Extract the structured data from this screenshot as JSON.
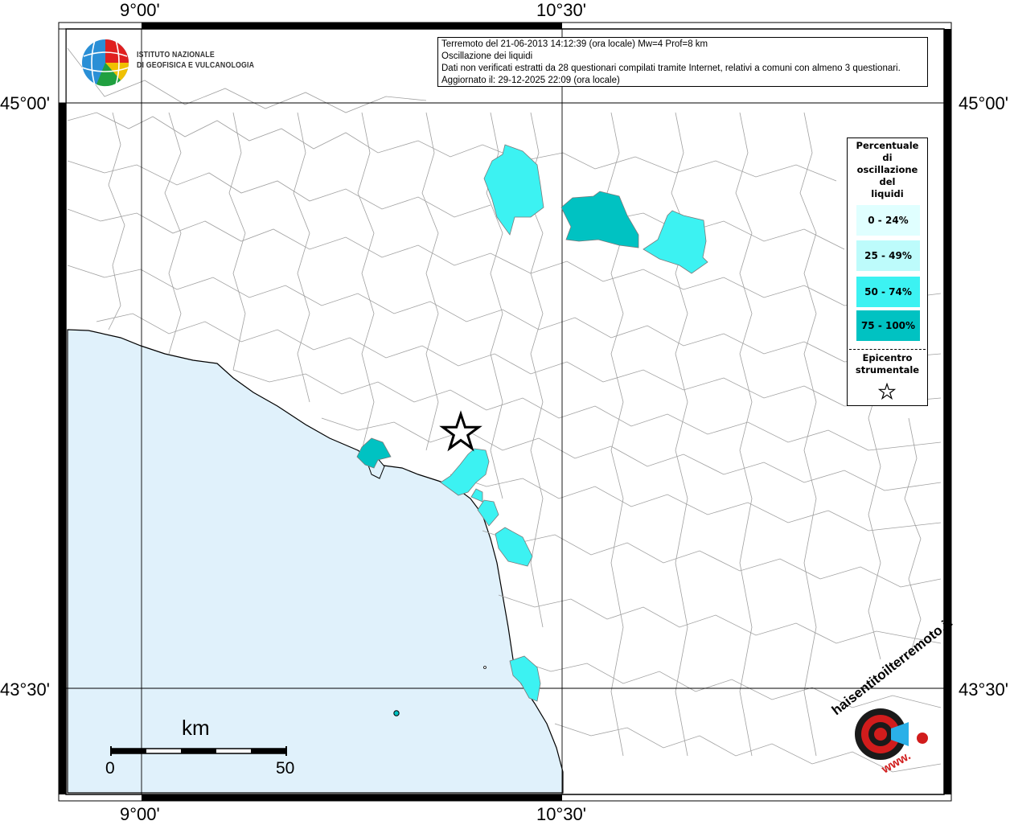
{
  "coordinate_labels": {
    "top_left": "9°00'",
    "top_right": "10°30'",
    "bottom_left": "9°00'",
    "bottom_right": "10°30'",
    "left_upper": "45°00'",
    "right_upper": "45°00'",
    "left_lower": "43°30'",
    "right_lower": "43°30'"
  },
  "info_box": {
    "line1": "Terremoto del 21-06-2013 14:12:39 (ora locale) Mw=4 Prof=8 km",
    "line2": "Oscillazione dei liquidi",
    "line3": "Dati non verificati estratti da 28 questionari compilati tramite Internet, relativi a comuni con almeno 3 questionari.",
    "line4": "Aggiornato il: 29-12-2025 22:09 (ora locale)"
  },
  "logo": {
    "line1": "ISTITUTO NAZIONALE",
    "line2": "DI GEOFISICA E VULCANOLOGIA"
  },
  "legend": {
    "title_lines": [
      "Percentuale",
      "di",
      "oscillazione",
      "del",
      "liquidi"
    ],
    "classes": [
      {
        "label": "0 - 24%",
        "color": "#e0ffff"
      },
      {
        "label": "25 - 49%",
        "color": "#bdfbfb"
      },
      {
        "label": "50 - 74%",
        "color": "#3cf2f2"
      },
      {
        "label": "75 - 100%",
        "color": "#00c2c2"
      }
    ],
    "epicenter_lines": [
      "Epicentro",
      "strumentale"
    ]
  },
  "scale_bar": {
    "unit": "km",
    "min_label": "0",
    "max_label": "50"
  },
  "watermark": {
    "text": "haisentitoilterremoto.it",
    "url_text": "www."
  },
  "colors": {
    "sea": "#e0f1fb",
    "border_lines": "#9a9a9a",
    "frame": "#000000"
  }
}
